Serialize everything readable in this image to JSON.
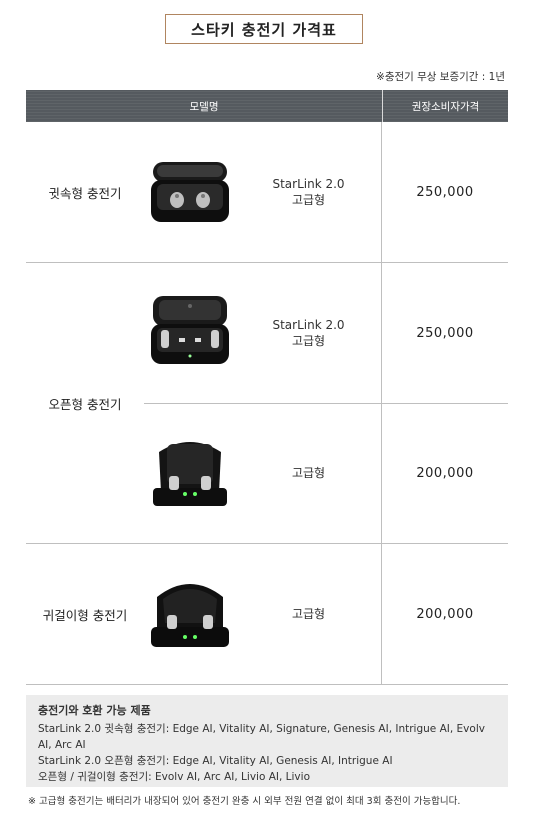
{
  "title": "스타키 충전기 가격표",
  "warranty": "※충전기 무상 보증기간 : 1년",
  "table": {
    "headers": [
      "모델명",
      "권장소비자가격"
    ],
    "rows": [
      {
        "category": "귓속형 충전기",
        "model_line1": "StarLink 2.0",
        "model_line2": "고급형",
        "price": "250,000",
        "image": "in-ear-charger-case"
      },
      {
        "category": "오픈형 충전기",
        "model_line1": "StarLink 2.0",
        "model_line2": "고급형",
        "price": "250,000",
        "image": "open-fit-charger-case"
      },
      {
        "category": "",
        "model_line1": "",
        "model_line2": "고급형",
        "price": "200,000",
        "image": "open-fit-standard-charger"
      },
      {
        "category": "귀걸이형 충전기",
        "model_line1": "",
        "model_line2": "고급형",
        "price": "200,000",
        "image": "bte-charger"
      }
    ]
  },
  "compat": {
    "heading": "충전기와 호환 가능 제품",
    "lines": [
      "StarLink 2.0 귓속형 충전기: Edge AI, Vitality AI, Signature, Genesis AI, Intrigue AI, Evolv AI, Arc AI",
      "StarLink 2.0 오픈형 충전기: Edge AI, Vitality AI, Genesis AI, Intrigue AI",
      "오픈형 / 귀걸이형 충전기: Evolv AI, Arc AI, Livio AI, Livio"
    ]
  },
  "footnote": "※ 고급형 충전기는 배터리가 내장되어 있어 충전기 완충 시 외부 전원 연결 없이 최대 3회 충전이 가능합니다."
}
